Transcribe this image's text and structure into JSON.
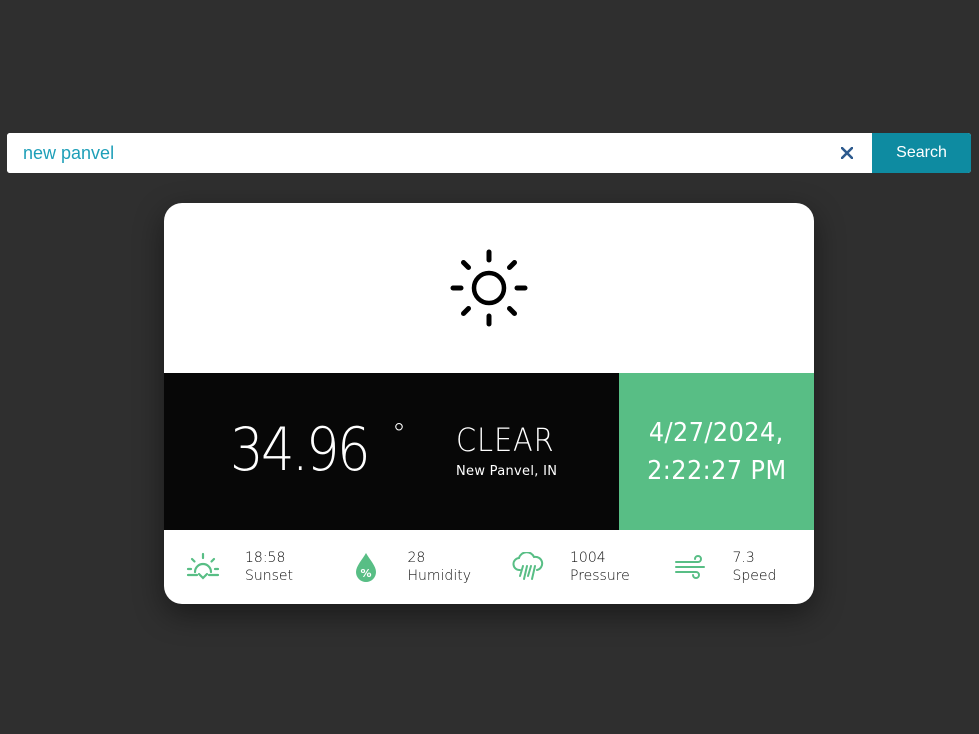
{
  "search": {
    "value": "new panvel",
    "button_label": "Search"
  },
  "weather": {
    "icon": "sun-icon",
    "temperature": "34.96",
    "unit": "°",
    "condition": "CLEAR",
    "location": "New Panvel, IN",
    "date": "4/27/2024,",
    "time": "2:22:27 PM"
  },
  "stats": [
    {
      "icon": "sunset-icon",
      "value": "18:58",
      "label": "Sunset"
    },
    {
      "icon": "humidity-icon",
      "value": "28",
      "label": "Humidity"
    },
    {
      "icon": "pressure-icon",
      "value": "1004",
      "label": "Pressure"
    },
    {
      "icon": "wind-icon",
      "value": "7.3",
      "label": "Speed"
    }
  ],
  "colors": {
    "background": "#2f2f2f",
    "accent": "#58be85",
    "search_button": "#0e8ba1",
    "input_text": "#1e9fb8"
  }
}
